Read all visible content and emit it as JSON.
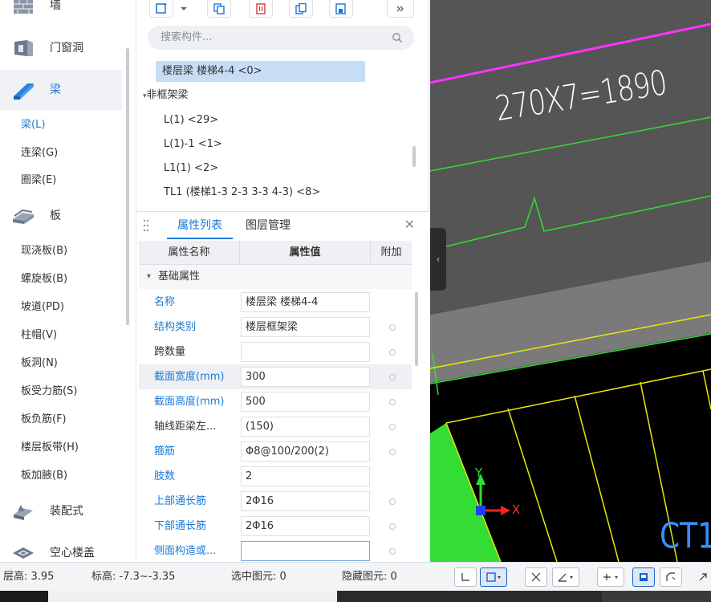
{
  "sidebar": {
    "categories": [
      {
        "label": "墙",
        "icon": "wall-icon"
      },
      {
        "label": "门窗洞",
        "icon": "door-window-icon"
      },
      {
        "label": "梁",
        "icon": "beam-icon"
      },
      {
        "label": "板",
        "icon": "slab-icon"
      },
      {
        "label": "装配式",
        "icon": "prefab-icon"
      },
      {
        "label": "空心楼盖",
        "icon": "hollow-floor-icon"
      }
    ],
    "beam_items": [
      "梁(L)",
      "连梁(G)",
      "圈梁(E)"
    ],
    "slab_items": [
      "现浇板(B)",
      "螺旋板(B)",
      "坡道(PD)",
      "柱帽(V)",
      "板洞(N)",
      "板受力筋(S)",
      "板负筋(F)",
      "楼层板带(H)",
      "板加腋(B)"
    ]
  },
  "toolbar": {
    "icons": [
      "new-component-icon",
      "dropdown-arrow-icon",
      "copy-icon",
      "delete-icon",
      "duplicate-icon",
      "save-layer-icon",
      "more-icon"
    ]
  },
  "search": {
    "placeholder": "搜索构件..."
  },
  "tree": {
    "selected": "楼层梁 楼梯4-4 <0>",
    "group": "非框架梁",
    "items": [
      "L(1) <29>",
      "L(1)-1 <1>",
      "L1(1) <2>",
      "TL1 (楼梯1-3 2-3 3-3 4-3) <8>"
    ]
  },
  "properties": {
    "tabs": [
      "属性列表",
      "图层管理"
    ],
    "columns": [
      "属性名称",
      "属性值",
      "附加"
    ],
    "group": "基础属性",
    "rows": [
      {
        "name": "名称",
        "value": "楼层梁 楼梯4-4"
      },
      {
        "name": "结构类别",
        "value": "楼层框架梁"
      },
      {
        "name": "跨数量",
        "value": ""
      },
      {
        "name": "截面宽度(mm)",
        "value": "300"
      },
      {
        "name": "截面高度(mm)",
        "value": "500"
      },
      {
        "name": "轴线距梁左...",
        "value": "(150)"
      },
      {
        "name": "箍筋",
        "value": "Φ8@100/200(2)"
      },
      {
        "name": "肢数",
        "value": "2"
      },
      {
        "name": "上部通长筋",
        "value": "2Φ16"
      },
      {
        "name": "下部通长筋",
        "value": "2Φ16"
      },
      {
        "name": "侧面构造或...",
        "value": ""
      }
    ]
  },
  "viewport": {
    "dimension_text": "270X7=1890",
    "label_text": "CT1",
    "axis_x": "X",
    "axis_y": "Y",
    "colors": {
      "magenta_line": "#ff33ff",
      "green_line": "#33dd33",
      "yellow_line": "#e8e80a",
      "slab_fill": "#7a7a7a",
      "stair_fill": "#000000",
      "green_fill": "#33dd33",
      "background": "#5a5a5a"
    }
  },
  "status": {
    "floor_height": "层高: 3.95",
    "elevation": "标高: -7.3~-3.35",
    "selected": "选中图元: 0",
    "hidden": "隐藏图元: 0"
  },
  "statusbar_tools": [
    "ortho-icon",
    "select-box-icon",
    "cross-select-icon",
    "angle-icon",
    "snap-icon",
    "display-icon",
    "polyline-icon",
    "expand-icon"
  ]
}
